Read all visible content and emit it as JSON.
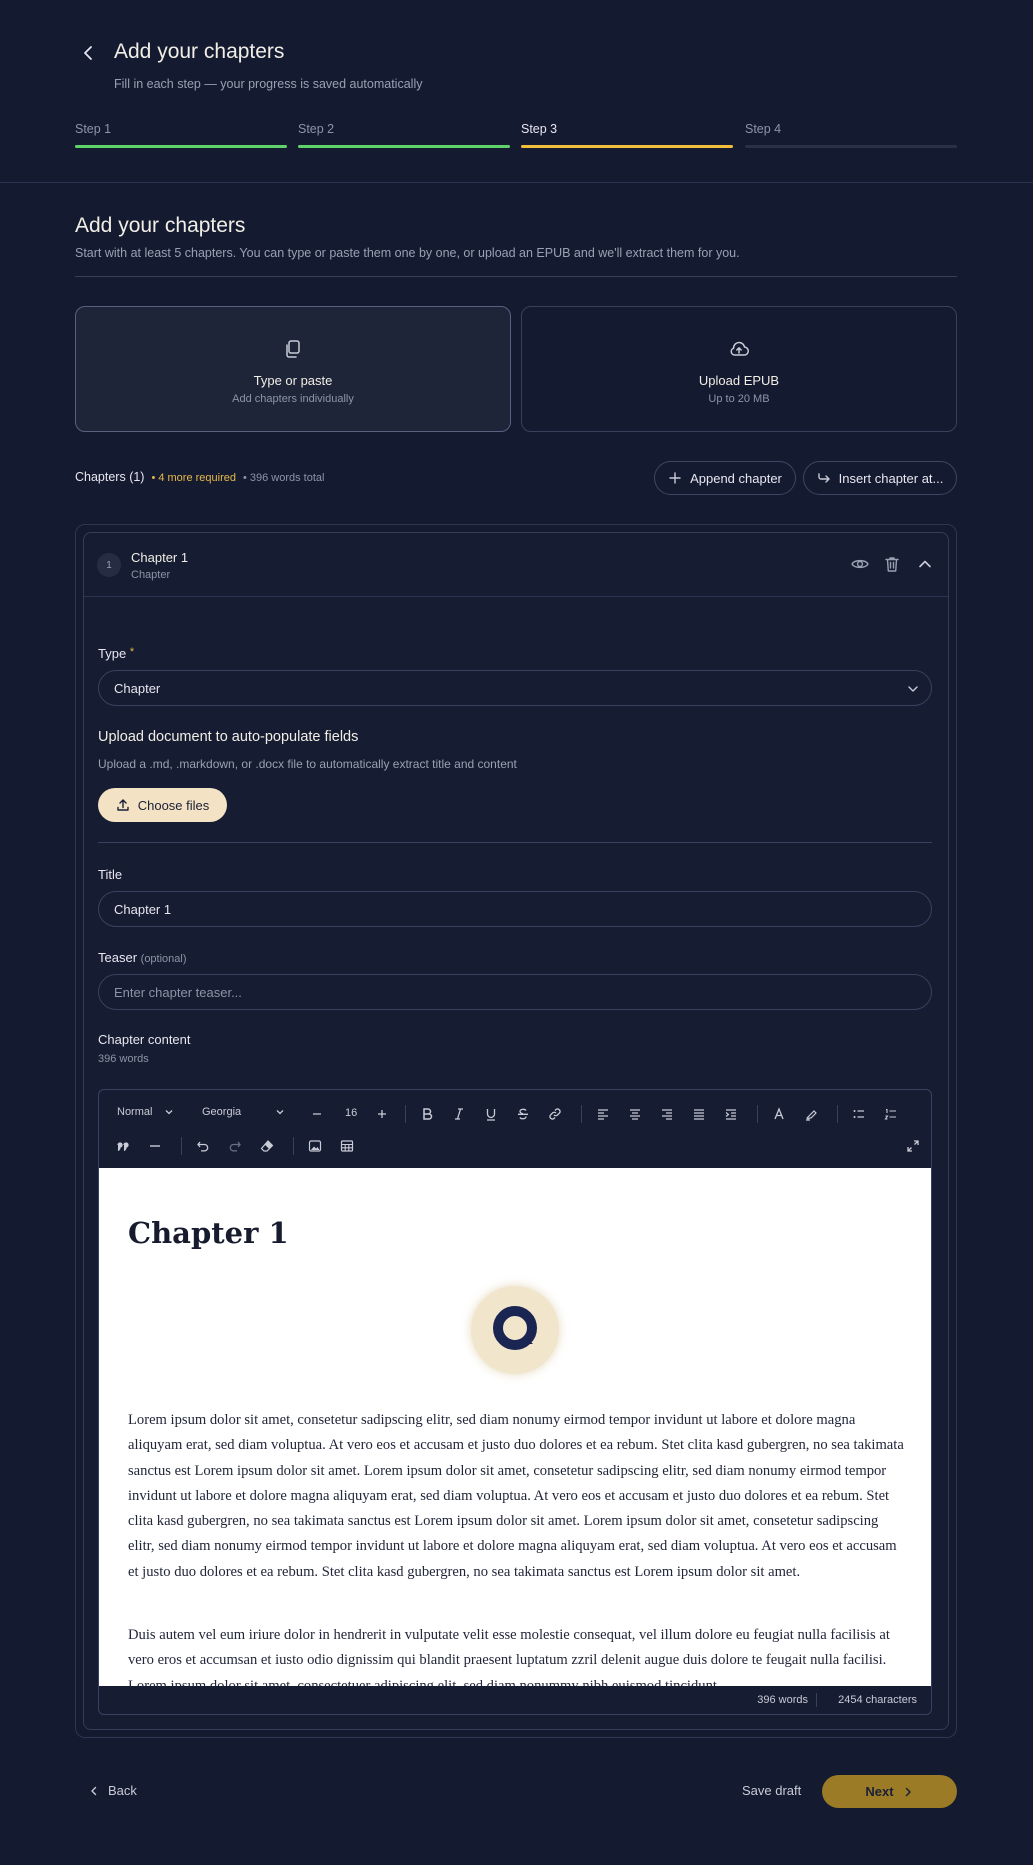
{
  "header": {
    "title": "Add your chapters",
    "subtitle": "Fill in each step — your progress is saved automatically",
    "steps": [
      {
        "label": "Step 1",
        "color": "#5fd26a"
      },
      {
        "label": "Step 2",
        "color": "#5fd26a"
      },
      {
        "label": "Step 3",
        "color": "#f2bd3a"
      },
      {
        "label": "Step 4",
        "color": "#2a3048"
      }
    ]
  },
  "section": {
    "title": "Add your chapters",
    "subtitle": "Start with at least 5 chapters. You can type or paste them one by one, or upload an EPUB and we'll extract them for you."
  },
  "options": [
    {
      "title": "Type or paste",
      "subtitle": "Add chapters individually",
      "icon": "copy-icon"
    },
    {
      "title": "Upload EPUB",
      "subtitle": "Up to 20 MB",
      "icon": "cloud-upload-icon"
    }
  ],
  "chapters_bar": {
    "count_label": "Chapters (1)",
    "required": "• 4 more required",
    "total": "• 396 words total",
    "append_label": "Append chapter",
    "insert_label": "Insert chapter at..."
  },
  "chapter": {
    "number": "1",
    "title": "Chapter 1",
    "subtitle": "Chapter",
    "type_label": "Type",
    "type_required": "*",
    "type_value": "Chapter",
    "upload_title": "Upload document to auto-populate fields",
    "upload_desc": "Upload a .md, .markdown, or .docx file to automatically extract title and content",
    "choose_label": "Choose files",
    "title_label": "Title",
    "title_value": "Chapter 1",
    "teaser_label": "Teaser",
    "teaser_optional": "(optional)",
    "teaser_placeholder": "Enter chapter teaser...",
    "content_label": "Chapter content",
    "content_words": "396 words"
  },
  "editor": {
    "style": "Normal",
    "font": "Georgia",
    "size": "16",
    "heading": "Chapter 1",
    "paragraph1": "Lorem ipsum dolor sit amet, consetetur sadipscing elitr, sed diam nonumy eirmod tempor invidunt ut labore et dolore magna aliquyam erat, sed diam voluptua. At vero eos et accusam et justo duo dolores et ea rebum. Stet clita kasd gubergren, no sea takimata sanctus est Lorem ipsum dolor sit amet. Lorem ipsum dolor sit amet, consetetur sadipscing elitr, sed diam nonumy eirmod tempor invidunt ut labore et dolore magna aliquyam erat, sed diam voluptua. At vero eos et accusam et justo duo dolores et ea rebum. Stet clita kasd gubergren, no sea takimata sanctus est Lorem ipsum dolor sit amet. Lorem ipsum dolor sit amet, consetetur sadipscing elitr, sed diam nonumy eirmod tempor invidunt ut labore et dolore magna aliquyam erat, sed diam voluptua. At vero eos et accusam et justo duo dolores et ea rebum. Stet clita kasd gubergren, no sea takimata sanctus est Lorem ipsum dolor sit amet.",
    "paragraph2": "Duis autem vel eum iriure dolor in hendrerit in vulputate velit esse molestie consequat, vel illum dolore eu feugiat nulla facilisis at vero eros et accumsan et iusto odio dignissim qui blandit praesent luptatum zzril delenit augue duis dolore te feugait nulla facilisi. Lorem ipsum dolor sit amet, consectetuer adipiscing elit, sed diam nonummy nibh euismod tincidunt",
    "word_count": "396 words",
    "char_count": "2454 characters"
  },
  "footer": {
    "back_label": "Back",
    "save_label": "Save draft",
    "next_label": "Next"
  },
  "colors": {
    "background": "#141a30",
    "accent": "#9b7b26",
    "warning": "#e8b84a",
    "cream": "#f3e3c4"
  }
}
